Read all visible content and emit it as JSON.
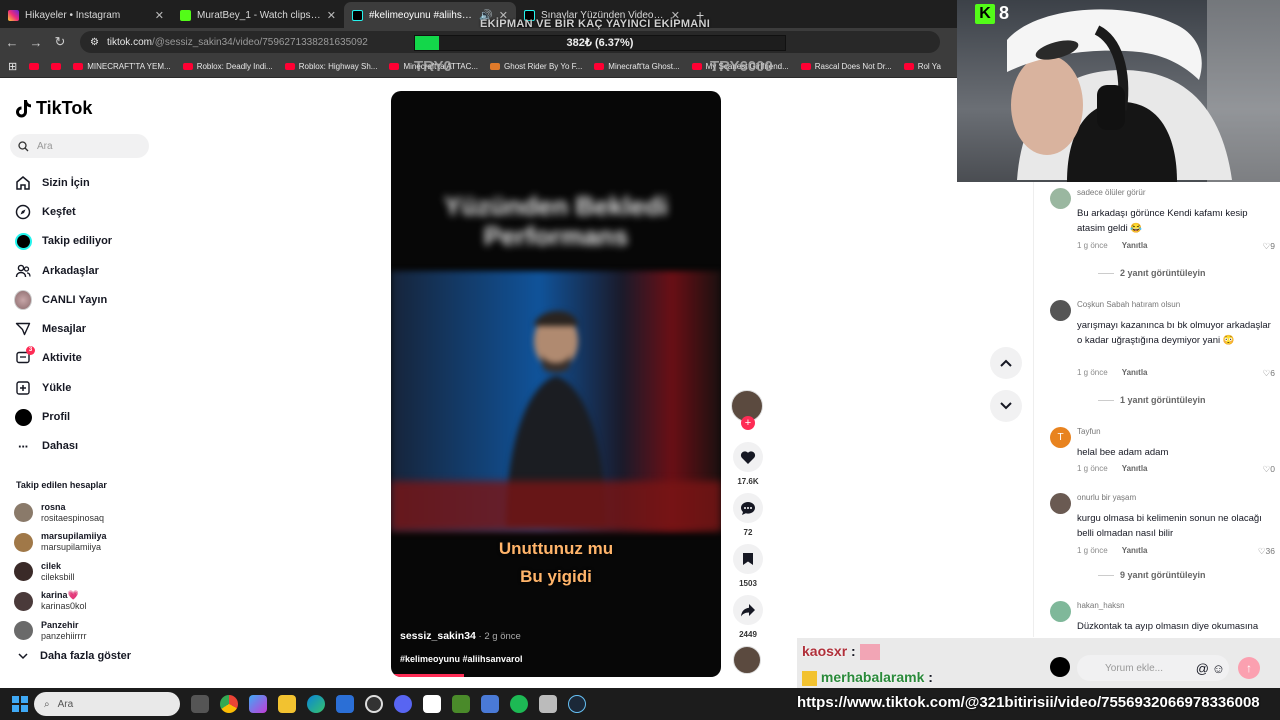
{
  "browser": {
    "tabs": [
      {
        "title": "Hikayeler • Instagram",
        "favicon_color": "#d6249f"
      },
      {
        "title": "MuratBey_1 - Watch clips on Ki",
        "favicon_color": "#53fc18"
      },
      {
        "title": "#kelimeoyunu #aliihsanvar",
        "favicon_color": "#000000",
        "active": true
      },
      {
        "title": "Sınavlar Yüzünden Video Atam",
        "favicon_color": "#000000"
      }
    ],
    "url_host": "tiktok.com",
    "url_path": "/@sessiz_sakin34/video/7596271338281635092",
    "bookmarks": [
      "MINECRAFT'TA YEM...",
      "Roblox: Deadly Indi...",
      "Roblox: Highway Sh...",
      "Minecraft'ta ATTAC...",
      "Ghost Rider By Yo F...",
      "Minecraft'ta Ghost...",
      "My Scariest Girlfriend...",
      "Rascal Does Not Dr...",
      "Rol Ya"
    ]
  },
  "overlay": {
    "title": "EKİPMAN VE BİR KAÇ YAYINCI EKİPMANI",
    "progress_text": "382₺ (6.37%)",
    "progress": 0.0637,
    "try_left": "TRY0",
    "try_right": "TRY6000",
    "kick_count": "8"
  },
  "sidebar": {
    "logo": "TikTok",
    "search_placeholder": "Ara",
    "nav": [
      {
        "label": "Sizin İçin",
        "icon": "home-icon"
      },
      {
        "label": "Keşfet",
        "icon": "compass-icon"
      },
      {
        "label": "Takip ediliyor",
        "icon": "following-icon"
      },
      {
        "label": "Arkadaşlar",
        "icon": "friends-icon"
      },
      {
        "label": "CANLI Yayın",
        "icon": "live-icon"
      },
      {
        "label": "Mesajlar",
        "icon": "messages-icon"
      },
      {
        "label": "Aktivite",
        "icon": "activity-icon",
        "badge": "3"
      },
      {
        "label": "Yükle",
        "icon": "upload-icon"
      },
      {
        "label": "Profil",
        "icon": "profile-icon"
      },
      {
        "label": "Dahası",
        "icon": "more-dots-icon"
      }
    ],
    "following_header": "Takip edilen hesaplar",
    "following": [
      {
        "name": "rosna",
        "user": "rositaespinosaq",
        "color": "#8a7a6a"
      },
      {
        "name": "marsupilamiiya",
        "user": "marsupilamiiya",
        "color": "#a07848"
      },
      {
        "name": "cilek",
        "user": "cileksbill",
        "color": "#3a2a28"
      },
      {
        "name": "karina💗",
        "user": "karinas0kol",
        "color": "#4a3a3a"
      },
      {
        "name": "Panzehir",
        "user": "panzehiirrrr",
        "color": "#6a6a6a"
      }
    ],
    "more_label": "Daha fazla göster"
  },
  "video": {
    "author": "sessiz_sakin34",
    "date": " · 2 g önce",
    "tags": "#kelimeoyunu #aliihsanvarol",
    "sub1": "Unuttunuz mu",
    "sub2": "Bu yigidi",
    "blur_text": "Yüzünden Bekledi Performans",
    "progress": 0.22
  },
  "actions": {
    "likes": "17.6K",
    "comments": "72",
    "saves": "1503",
    "shares": "2449"
  },
  "comments": [
    {
      "user": "sadece ölüler görür",
      "text": "Bu arkadaşı görünce Kendi kafamı kesip atasim geldi 😂",
      "time": "1 g önce",
      "reply": "Yanıtla",
      "likes": "9",
      "replies": "2 yanıt görüntüleyin",
      "color": "#9ab7a0"
    },
    {
      "user": "Coşkun Sabah hatıram olsun",
      "text": "yarışmayı kazanınca bı bk olmuyor arkadaşlar o kadar uğraştığına deymiyor yani 😳",
      "time": "1 g önce",
      "reply": "Yanıtla",
      "likes": "6",
      "replies": "1 yanıt görüntüleyin",
      "color": "#555555"
    },
    {
      "user": "Tayfun",
      "text": "helal bee adam adam",
      "time": "1 g önce",
      "reply": "Yanıtla",
      "likes": "0",
      "replies": "",
      "color": "#e8831f",
      "initial": "T"
    },
    {
      "user": "onurlu bir yaşam",
      "text": "kurgu olmasa bi kelimenin sonun ne olacağı belli olmadan nasıl bilir",
      "time": "1 g önce",
      "reply": "Yanıtla",
      "likes": "36",
      "replies": "9 yanıt görüntüleyin",
      "color": "#6a5a52"
    },
    {
      "user": "hakan_haksn",
      "text": "Düzkontak ta ayıp olmasın diye okumasına müsade etti",
      "time": "",
      "reply": "",
      "likes": "",
      "replies": "",
      "color": "#7fb89a"
    }
  ],
  "comment_input_placeholder": "Yorum ekle...",
  "chat": [
    {
      "user": "kaosxr",
      "sep": " :",
      "color": "#b0303a"
    },
    {
      "user": "merhabalaramk",
      "sep": " :",
      "color": "#2a8a3a"
    }
  ],
  "taskbar": {
    "search_placeholder": "Ara",
    "overlay_url": "https://www.tiktok.com/@321bitirisii/video/7556932066978336008",
    "icons": [
      "task-view-icon",
      "chrome-icon",
      "copilot-icon",
      "folder-icon",
      "edge-icon",
      "store-icon",
      "obs-icon",
      "discord-icon",
      "capcut-icon",
      "minecraft-icon",
      "app-icon",
      "spotify-icon",
      "app2-icon",
      "steam-icon"
    ]
  }
}
